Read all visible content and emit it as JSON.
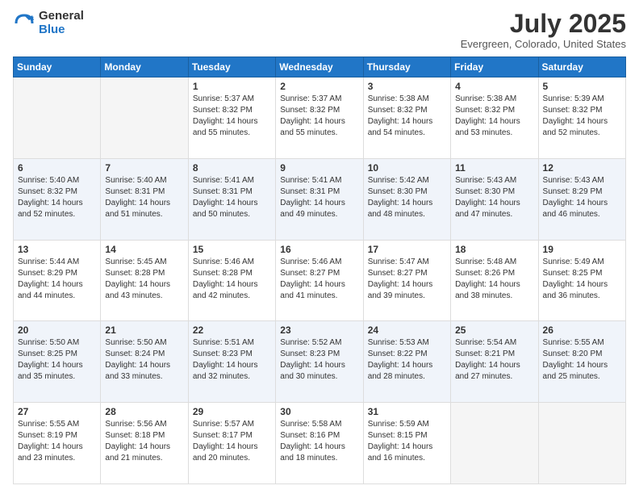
{
  "logo": {
    "general": "General",
    "blue": "Blue"
  },
  "header": {
    "month": "July 2025",
    "location": "Evergreen, Colorado, United States"
  },
  "weekdays": [
    "Sunday",
    "Monday",
    "Tuesday",
    "Wednesday",
    "Thursday",
    "Friday",
    "Saturday"
  ],
  "weeks": [
    [
      {
        "day": "",
        "info": ""
      },
      {
        "day": "",
        "info": ""
      },
      {
        "day": "1",
        "info": "Sunrise: 5:37 AM\nSunset: 8:32 PM\nDaylight: 14 hours and 55 minutes."
      },
      {
        "day": "2",
        "info": "Sunrise: 5:37 AM\nSunset: 8:32 PM\nDaylight: 14 hours and 55 minutes."
      },
      {
        "day": "3",
        "info": "Sunrise: 5:38 AM\nSunset: 8:32 PM\nDaylight: 14 hours and 54 minutes."
      },
      {
        "day": "4",
        "info": "Sunrise: 5:38 AM\nSunset: 8:32 PM\nDaylight: 14 hours and 53 minutes."
      },
      {
        "day": "5",
        "info": "Sunrise: 5:39 AM\nSunset: 8:32 PM\nDaylight: 14 hours and 52 minutes."
      }
    ],
    [
      {
        "day": "6",
        "info": "Sunrise: 5:40 AM\nSunset: 8:32 PM\nDaylight: 14 hours and 52 minutes."
      },
      {
        "day": "7",
        "info": "Sunrise: 5:40 AM\nSunset: 8:31 PM\nDaylight: 14 hours and 51 minutes."
      },
      {
        "day": "8",
        "info": "Sunrise: 5:41 AM\nSunset: 8:31 PM\nDaylight: 14 hours and 50 minutes."
      },
      {
        "day": "9",
        "info": "Sunrise: 5:41 AM\nSunset: 8:31 PM\nDaylight: 14 hours and 49 minutes."
      },
      {
        "day": "10",
        "info": "Sunrise: 5:42 AM\nSunset: 8:30 PM\nDaylight: 14 hours and 48 minutes."
      },
      {
        "day": "11",
        "info": "Sunrise: 5:43 AM\nSunset: 8:30 PM\nDaylight: 14 hours and 47 minutes."
      },
      {
        "day": "12",
        "info": "Sunrise: 5:43 AM\nSunset: 8:29 PM\nDaylight: 14 hours and 46 minutes."
      }
    ],
    [
      {
        "day": "13",
        "info": "Sunrise: 5:44 AM\nSunset: 8:29 PM\nDaylight: 14 hours and 44 minutes."
      },
      {
        "day": "14",
        "info": "Sunrise: 5:45 AM\nSunset: 8:28 PM\nDaylight: 14 hours and 43 minutes."
      },
      {
        "day": "15",
        "info": "Sunrise: 5:46 AM\nSunset: 8:28 PM\nDaylight: 14 hours and 42 minutes."
      },
      {
        "day": "16",
        "info": "Sunrise: 5:46 AM\nSunset: 8:27 PM\nDaylight: 14 hours and 41 minutes."
      },
      {
        "day": "17",
        "info": "Sunrise: 5:47 AM\nSunset: 8:27 PM\nDaylight: 14 hours and 39 minutes."
      },
      {
        "day": "18",
        "info": "Sunrise: 5:48 AM\nSunset: 8:26 PM\nDaylight: 14 hours and 38 minutes."
      },
      {
        "day": "19",
        "info": "Sunrise: 5:49 AM\nSunset: 8:25 PM\nDaylight: 14 hours and 36 minutes."
      }
    ],
    [
      {
        "day": "20",
        "info": "Sunrise: 5:50 AM\nSunset: 8:25 PM\nDaylight: 14 hours and 35 minutes."
      },
      {
        "day": "21",
        "info": "Sunrise: 5:50 AM\nSunset: 8:24 PM\nDaylight: 14 hours and 33 minutes."
      },
      {
        "day": "22",
        "info": "Sunrise: 5:51 AM\nSunset: 8:23 PM\nDaylight: 14 hours and 32 minutes."
      },
      {
        "day": "23",
        "info": "Sunrise: 5:52 AM\nSunset: 8:23 PM\nDaylight: 14 hours and 30 minutes."
      },
      {
        "day": "24",
        "info": "Sunrise: 5:53 AM\nSunset: 8:22 PM\nDaylight: 14 hours and 28 minutes."
      },
      {
        "day": "25",
        "info": "Sunrise: 5:54 AM\nSunset: 8:21 PM\nDaylight: 14 hours and 27 minutes."
      },
      {
        "day": "26",
        "info": "Sunrise: 5:55 AM\nSunset: 8:20 PM\nDaylight: 14 hours and 25 minutes."
      }
    ],
    [
      {
        "day": "27",
        "info": "Sunrise: 5:55 AM\nSunset: 8:19 PM\nDaylight: 14 hours and 23 minutes."
      },
      {
        "day": "28",
        "info": "Sunrise: 5:56 AM\nSunset: 8:18 PM\nDaylight: 14 hours and 21 minutes."
      },
      {
        "day": "29",
        "info": "Sunrise: 5:57 AM\nSunset: 8:17 PM\nDaylight: 14 hours and 20 minutes."
      },
      {
        "day": "30",
        "info": "Sunrise: 5:58 AM\nSunset: 8:16 PM\nDaylight: 14 hours and 18 minutes."
      },
      {
        "day": "31",
        "info": "Sunrise: 5:59 AM\nSunset: 8:15 PM\nDaylight: 14 hours and 16 minutes."
      },
      {
        "day": "",
        "info": ""
      },
      {
        "day": "",
        "info": ""
      }
    ]
  ]
}
